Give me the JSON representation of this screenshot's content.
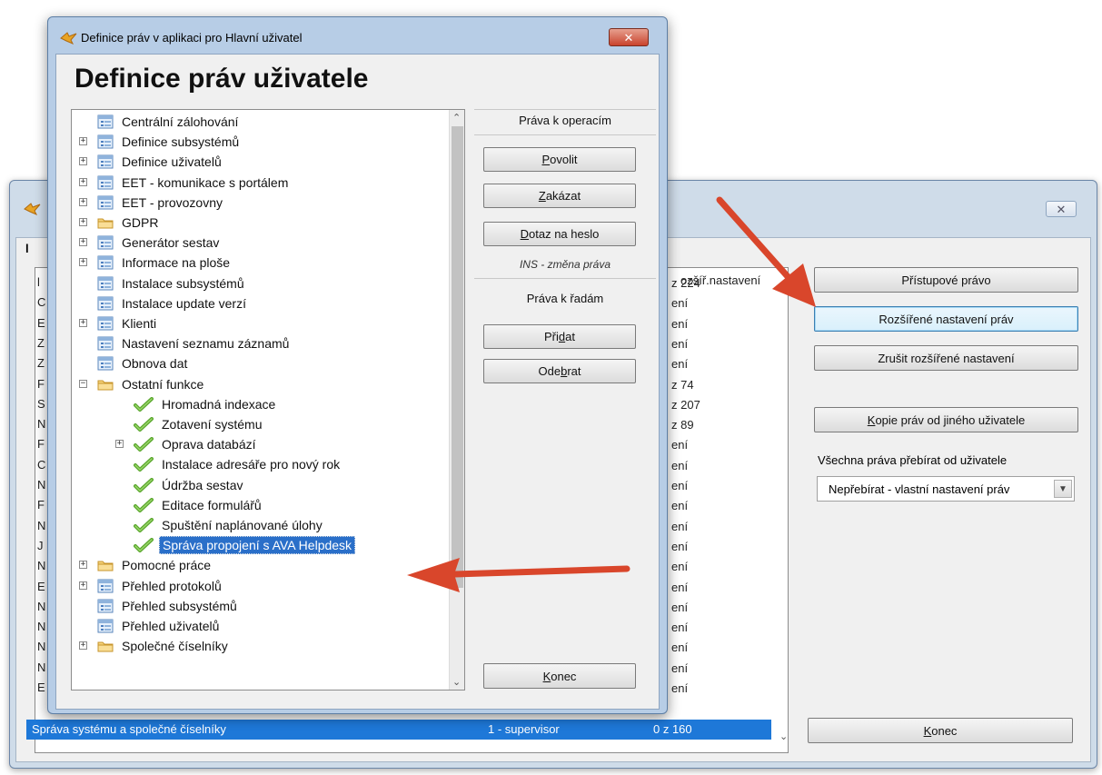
{
  "front_window": {
    "title": "Definice práv v aplikaci pro Hlavní uživatel",
    "close_label": "✕",
    "heading": "Definice práv uživatele",
    "tree": [
      {
        "label": "Centrální zálohování",
        "expandable": false,
        "level": 0,
        "icon": "table-icon"
      },
      {
        "label": "Definice subsystémů",
        "expandable": true,
        "level": 0,
        "icon": "table-icon"
      },
      {
        "label": "Definice uživatelů",
        "expandable": true,
        "level": 0,
        "icon": "table-icon"
      },
      {
        "label": "EET - komunikace s portálem",
        "expandable": true,
        "level": 0,
        "icon": "table-icon"
      },
      {
        "label": "EET - provozovny",
        "expandable": true,
        "level": 0,
        "icon": "table-icon"
      },
      {
        "label": "GDPR",
        "expandable": true,
        "level": 0,
        "icon": "folder-icon"
      },
      {
        "label": "Generátor sestav",
        "expandable": true,
        "level": 0,
        "icon": "table-icon"
      },
      {
        "label": "Informace na ploše",
        "expandable": true,
        "level": 0,
        "icon": "table-icon"
      },
      {
        "label": "Instalace subsystémů",
        "expandable": false,
        "level": 0,
        "icon": "table-icon"
      },
      {
        "label": "Instalace update verzí",
        "expandable": false,
        "level": 0,
        "icon": "table-icon"
      },
      {
        "label": "Klienti",
        "expandable": true,
        "level": 0,
        "icon": "table-icon"
      },
      {
        "label": "Nastavení seznamu záznamů",
        "expandable": false,
        "level": 0,
        "icon": "table-icon"
      },
      {
        "label": "Obnova dat",
        "expandable": false,
        "level": 0,
        "icon": "table-icon"
      },
      {
        "label": "Ostatní funkce",
        "expandable": true,
        "expanded": true,
        "level": 0,
        "icon": "folder-icon"
      },
      {
        "label": "Hromadná indexace",
        "expandable": false,
        "level": 1,
        "icon": "checkmark-icon"
      },
      {
        "label": "Zotavení systému",
        "expandable": false,
        "level": 1,
        "icon": "checkmark-icon"
      },
      {
        "label": "Oprava databází",
        "expandable": true,
        "level": 1,
        "icon": "checkmark-icon"
      },
      {
        "label": "Instalace adresáře pro nový rok",
        "expandable": false,
        "level": 1,
        "icon": "checkmark-icon"
      },
      {
        "label": "Údržba sestav",
        "expandable": false,
        "level": 1,
        "icon": "checkmark-icon"
      },
      {
        "label": "Editace formulářů",
        "expandable": false,
        "level": 1,
        "icon": "checkmark-icon"
      },
      {
        "label": "Spuštění naplánované úlohy",
        "expandable": false,
        "level": 1,
        "icon": "checkmark-icon"
      },
      {
        "label": "Správa propojení s AVA Helpdesk",
        "expandable": false,
        "level": 1,
        "icon": "checkmark-icon",
        "selected": true
      },
      {
        "label": "Pomocné práce",
        "expandable": true,
        "level": 0,
        "icon": "folder-icon"
      },
      {
        "label": "Přehled protokolů",
        "expandable": true,
        "level": 0,
        "icon": "table-icon"
      },
      {
        "label": "Přehled subsystémů",
        "expandable": false,
        "level": 0,
        "icon": "table-icon"
      },
      {
        "label": "Přehled uživatelů",
        "expandable": false,
        "level": 0,
        "icon": "table-icon"
      },
      {
        "label": "Společné číselníky",
        "expandable": true,
        "level": 0,
        "icon": "folder-icon"
      }
    ],
    "panel": {
      "ops_label": "Práva k operacím",
      "allow_pre": "",
      "allow_key": "P",
      "allow_post": "ovolit",
      "deny_pre": "",
      "deny_key": "Z",
      "deny_post": "akázat",
      "password_pre": "",
      "password_key": "D",
      "password_post": "otaz na heslo",
      "ins_hint": "INS - změna práva",
      "rows_label": "Práva k řadám",
      "add_pre": "Při",
      "add_key": "d",
      "add_post": "at",
      "remove_pre": "Ode",
      "remove_key": "b",
      "remove_post": "rat",
      "end_pre": "",
      "end_key": "K",
      "end_post": "onec"
    }
  },
  "back_window": {
    "close_label": "✕",
    "side_tab_letter": "l",
    "column_header": "ozšíř.nastavení",
    "left_letters": [
      "l",
      "C",
      "E",
      "Z",
      "Z",
      "F",
      "S",
      "N",
      "F",
      "C",
      "N",
      "F",
      "N",
      "J",
      "N",
      "E",
      "N",
      "N",
      "N",
      "N",
      "E"
    ],
    "col3_values": [
      "z 224",
      "ení",
      "ení",
      "ení",
      "ení",
      "z 74",
      "z 207",
      "z 89",
      "ení",
      "ení",
      "ení",
      "ení",
      "ení",
      "ení",
      "ení",
      "ení",
      "ení",
      "ení",
      "ení",
      "ení",
      "ení"
    ],
    "selected_row": {
      "name": "Správa systému a společné číselníky",
      "role": "1 - supervisor",
      "count": "0 z 160"
    },
    "buttons": {
      "access_right": "Přístupové právo",
      "extended_settings": "Rozšířené nastavení práv",
      "cancel_extended": "Zrušit rozšířené nastavení",
      "copy_pre": "",
      "copy_key": "K",
      "copy_post": "opie práv od jiného uživatele",
      "end_pre": "",
      "end_key": "K",
      "end_post": "onec"
    },
    "inherit_label": "Všechna práva přebírat od uživatele",
    "inherit_value": "Nepřebírat - vlastní nastavení práv"
  },
  "colors": {
    "selection": "#1e78d8",
    "arrow": "#d9462b",
    "window_frame": "#b7cde6"
  }
}
